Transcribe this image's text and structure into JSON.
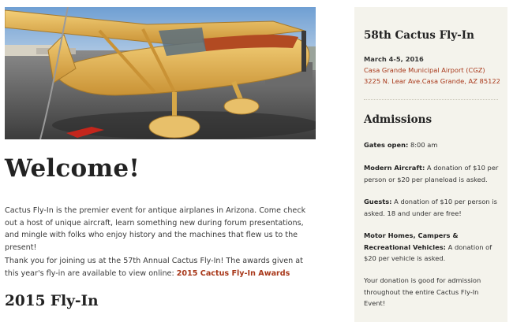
{
  "main": {
    "hero_alt": "Yellow antique airplane on the tarmac",
    "welcome": "Welcome!",
    "intro": "Cactus Fly-In is the premier event for antique airplanes in Arizona. Come check out a host of unique aircraft, learn something new during forum presentations, and mingle with folks who enjoy history and the machines that flew us to the present!",
    "thanks_text": "Thank you for joining us at the 57th Annual Cactus Fly-In! The awards given at this year's fly-in are available to view online: ",
    "awards_link": "2015 Cactus Fly-In Awards",
    "section_heading": "2015 Fly-In"
  },
  "sidebar": {
    "event_title": "58th Cactus Fly-In",
    "date": "March 4-5, 2016",
    "airport_link": "Casa Grande Municipal Airport (CGZ)",
    "address_link": "3225 N. Lear Ave.Casa Grande, AZ 85122",
    "admissions_title": "Admissions",
    "gates_label": "Gates open:",
    "gates_value": " 8:00 am",
    "modern_label": "Modern Aircraft:",
    "modern_value": " A donation of $10 per person or $20 per planeload is asked.",
    "guests_label": "Guests:",
    "guests_value": " A donation of $10 per person is asked. 18 and under are free!",
    "rv_label": "Motor Homes, Campers & Recreational Vehicles:",
    "rv_value": " A donation of $20 per vehicle is asked.",
    "donation_note": "Your donation is good for admission throughout the entire Cactus Fly-In Event!"
  },
  "colors": {
    "accent_link": "#a8381a",
    "sidebar_bg": "#f4f3ec",
    "plane_yellow": "#e9b94e"
  }
}
